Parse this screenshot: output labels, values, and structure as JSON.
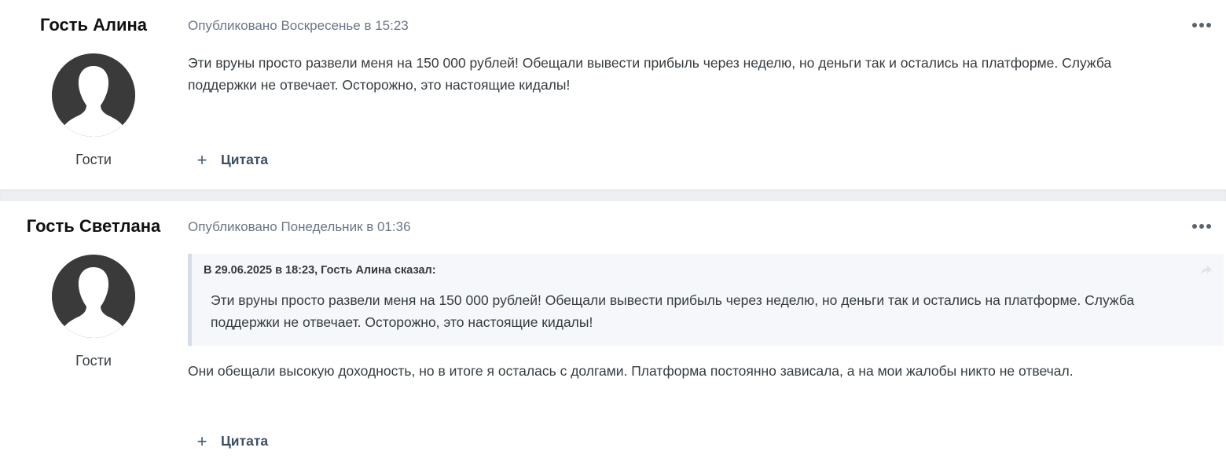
{
  "posts": [
    {
      "author": "Гость Алина",
      "group": "Гости",
      "meta": "Опубликовано Воскресенье в 15:23",
      "text": "Эти вруны просто развели меня на 150 000 рублей! Обещали вывести прибыль через неделю, но деньги так и остались на платформе. Служба поддержки не отвечает. Осторожно, это настоящие кидалы!",
      "quote_label": "Цитата"
    },
    {
      "author": "Гость Светлана",
      "group": "Гости",
      "meta": "Опубликовано Понедельник в 01:36",
      "quote": {
        "citation": "В 29.06.2025 в 18:23, Гость Алина сказал:",
        "text": "Эти вруны просто развели меня на 150 000 рублей! Обещали вывести прибыль через неделю, но деньги так и остались на платформе. Служба поддержки не отвечает. Осторожно, это настоящие кидалы!"
      },
      "text": "Они обещали высокую доходность, но в итоге я осталась с долгами. Платформа постоянно зависала, а на мои жалобы никто не отвечал.",
      "quote_label": "Цитата"
    }
  ],
  "icons": {
    "avatar": "default-user-silhouette-icon",
    "more": "more-horizontal-icon",
    "quote_add": "plus-icon",
    "share": "share-arrow-icon"
  },
  "colors": {
    "author_name": "#111111",
    "meta": "#6a7787",
    "body_text": "#353c41",
    "quote_bg": "#f5f7fa",
    "quote_border": "#d6dde6",
    "separator": "#edeff3",
    "avatar_bg": "#3a3a3a",
    "quote_action": "#3d5a7a"
  }
}
